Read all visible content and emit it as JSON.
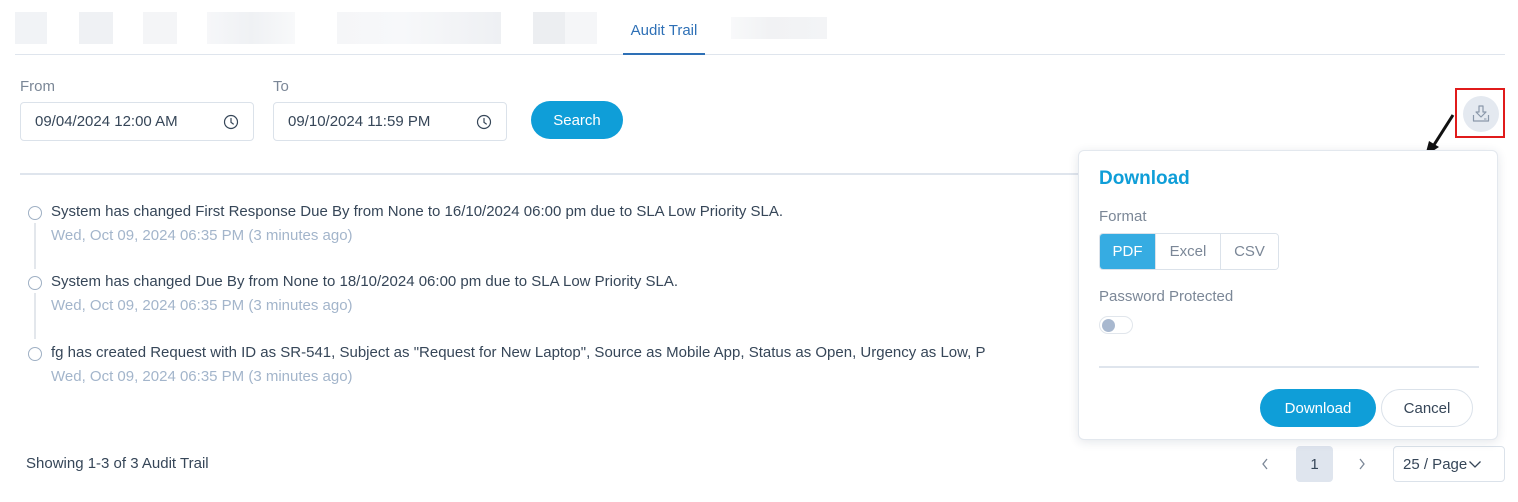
{
  "tabs": {
    "active_label": "Audit Trail"
  },
  "filters": {
    "from_label": "From",
    "from_value": "09/04/2024 12:00 AM",
    "to_label": "To",
    "to_value": "09/10/2024 11:59 PM",
    "search_label": "Search",
    "export_icon": "download-icon"
  },
  "audit_entries": [
    {
      "message": "System has changed First Response Due By from None to 16/10/2024 06:00 pm due to SLA Low Priority SLA.",
      "time": "Wed, Oct 09, 2024 06:35 PM (3 minutes ago)"
    },
    {
      "message": "System has changed Due By from None to 18/10/2024 06:00 pm due to SLA Low Priority SLA.",
      "time": "Wed, Oct 09, 2024 06:35 PM (3 minutes ago)"
    },
    {
      "message": "fg has created Request with ID as SR-541, Subject as \"Request for New Laptop\", Source as Mobile App, Status as Open, Urgency as Low, P",
      "time": "Wed, Oct 09, 2024 06:35 PM (3 minutes ago)"
    }
  ],
  "footer": {
    "showing": "Showing 1-3 of 3 Audit Trail",
    "current_page": "1",
    "prev_icon": "‹",
    "next_icon": "›",
    "per_page": "25 / Page"
  },
  "download_popover": {
    "title": "Download",
    "format_label": "Format",
    "formats": [
      "PDF",
      "Excel",
      "CSV"
    ],
    "selected_format": "PDF",
    "password_label": "Password Protected",
    "password_enabled": false,
    "download_label": "Download",
    "cancel_label": "Cancel"
  },
  "colors": {
    "accent": "#0f9ed8",
    "tab_active": "#2e70b6",
    "annotation_box": "#e01b1b"
  }
}
